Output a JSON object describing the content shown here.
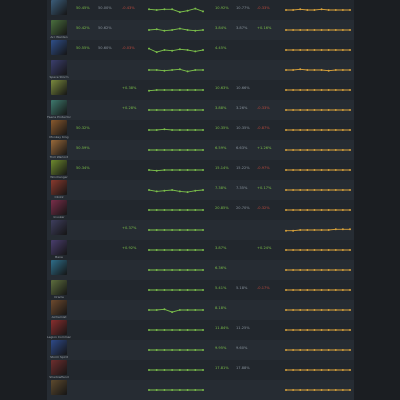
{
  "colors": {
    "win_line": "#7bbf4a",
    "pick_line": "#d9a23a",
    "positive": "#7bbf4a",
    "negative": "#b94a3e"
  },
  "heroes": [
    {
      "name": "",
      "icon": "hero-portrait-icon",
      "color": "#3b5d7a",
      "win_rate": "50.45%",
      "avg_win": "50.00%",
      "win_change": "-0.43%",
      "win_trend": [
        0.55,
        0.5,
        0.55,
        0.55,
        0.35,
        0.45,
        0.6,
        0.4
      ],
      "pick_rate": "10.92%",
      "avg_pick": "10.77%",
      "pick_change": "-0.33%",
      "pick_trend": [
        0.5,
        0.5,
        0.55,
        0.5,
        0.5,
        0.55,
        0.5,
        0.5,
        0.5,
        0.5
      ]
    },
    {
      "name": "Arc Warden",
      "icon": "hero-portrait-icon",
      "color": "#4a6f3e",
      "win_rate": "50.42%",
      "avg_win": "50.62%",
      "win_change": "",
      "win_trend": [
        0.5,
        0.55,
        0.45,
        0.5,
        0.6,
        0.5,
        0.45,
        0.5
      ],
      "pick_rate": "3.84%",
      "avg_pick": "3.87%",
      "pick_change": "+0.16%",
      "pick_trend": [
        0.5,
        0.5,
        0.5,
        0.5,
        0.5,
        0.5,
        0.5,
        0.5,
        0.5,
        0.5
      ]
    },
    {
      "name": "",
      "icon": "hero-portrait-icon",
      "color": "#2f4f8a",
      "win_rate": "50.55%",
      "avg_win": "50.60%",
      "win_change": "-0.03%",
      "win_trend": [
        0.6,
        0.35,
        0.5,
        0.45,
        0.55,
        0.5,
        0.4,
        0.5
      ],
      "pick_rate": "4.45%",
      "avg_pick": "",
      "pick_change": "",
      "pick_trend": [
        0.5,
        0.5,
        0.5,
        0.5,
        0.5,
        0.5,
        0.5,
        0.5,
        0.5,
        0.5
      ]
    },
    {
      "name": "Space Storm",
      "icon": "hero-portrait-icon",
      "color": "#3b3f6e",
      "win_rate": "",
      "avg_win": "",
      "win_change": "",
      "win_trend": [
        0.5,
        0.5,
        0.45,
        0.5,
        0.55,
        0.4,
        0.5,
        0.5
      ],
      "pick_rate": "",
      "avg_pick": "",
      "pick_change": "",
      "pick_trend": [
        0.5,
        0.5,
        0.55,
        0.5,
        0.5,
        0.5,
        0.45,
        0.5,
        0.5,
        0.5
      ]
    },
    {
      "name": "",
      "icon": "hero-portrait-icon",
      "color": "#7a8a3e",
      "win_rate": "",
      "avg_win": "",
      "win_change": "+0.38%",
      "win_trend": [
        0.45,
        0.5,
        0.5,
        0.5,
        0.5,
        0.5,
        0.5,
        0.5
      ],
      "pick_rate": "10.63%",
      "avg_pick": "10.66%",
      "pick_change": "",
      "pick_trend": [
        0.5,
        0.5,
        0.5,
        0.5,
        0.5,
        0.5,
        0.5,
        0.5,
        0.5,
        0.5
      ]
    },
    {
      "name": "Faerie Protector",
      "icon": "hero-portrait-icon",
      "color": "#3e7a6e",
      "win_rate": "",
      "avg_win": "",
      "win_change": "+0.28%",
      "win_trend": [
        0.5,
        0.5,
        0.5,
        0.5,
        0.5,
        0.5,
        0.5,
        0.5
      ],
      "pick_rate": "3.88%",
      "avg_pick": "3.26%",
      "pick_change": "-0.33%",
      "pick_trend": [
        0.5,
        0.5,
        0.5,
        0.5,
        0.5,
        0.5,
        0.5,
        0.5,
        0.5,
        0.5
      ]
    },
    {
      "name": "Monkey King",
      "icon": "hero-portrait-icon",
      "color": "#8a5a2e",
      "win_rate": "50.32%",
      "avg_win": "",
      "win_change": "",
      "win_trend": [
        0.5,
        0.5,
        0.55,
        0.5,
        0.5,
        0.5,
        0.5,
        0.5
      ],
      "pick_rate": "10.35%",
      "avg_pick": "10.35%",
      "pick_change": "-0.87%",
      "pick_trend": [
        0.5,
        0.5,
        0.5,
        0.5,
        0.5,
        0.5,
        0.5,
        0.5,
        0.5,
        0.5
      ]
    },
    {
      "name": "Troll Warlord",
      "icon": "hero-portrait-icon",
      "color": "#9a6a3a",
      "win_rate": "50.59%",
      "avg_win": "",
      "win_change": "",
      "win_trend": [
        0.5,
        0.5,
        0.5,
        0.5,
        0.5,
        0.5,
        0.5,
        0.5
      ],
      "pick_rate": "6.59%",
      "avg_pick": "6.63%",
      "pick_change": "+1.26%",
      "pick_trend": [
        0.5,
        0.5,
        0.5,
        0.5,
        0.5,
        0.5,
        0.5,
        0.5,
        0.5,
        0.5
      ]
    },
    {
      "name": "Windranger",
      "icon": "hero-portrait-icon",
      "color": "#6e8a2e",
      "win_rate": "50.34%",
      "avg_win": "",
      "win_change": "",
      "win_trend": [
        0.5,
        0.45,
        0.5,
        0.5,
        0.5,
        0.5,
        0.5,
        0.5
      ],
      "pick_rate": "15.14%",
      "avg_pick": "15.22%",
      "pick_change": "-0.97%",
      "pick_trend": [
        0.5,
        0.5,
        0.5,
        0.5,
        0.5,
        0.5,
        0.5,
        0.5,
        0.5,
        0.5
      ]
    },
    {
      "name": "Clinkz",
      "icon": "hero-portrait-icon",
      "color": "#8a3a2e",
      "win_rate": "",
      "avg_win": "",
      "win_change": "",
      "win_trend": [
        0.5,
        0.4,
        0.45,
        0.5,
        0.4,
        0.35,
        0.45,
        0.5
      ],
      "pick_rate": "7.38%",
      "avg_pick": "7.35%",
      "pick_change": "+0.17%",
      "pick_trend": [
        0.5,
        0.5,
        0.5,
        0.5,
        0.5,
        0.5,
        0.5,
        0.5,
        0.5,
        0.5
      ]
    },
    {
      "name": "Invoker",
      "icon": "hero-portrait-icon",
      "color": "#7a2e4a",
      "win_rate": "",
      "avg_win": "",
      "win_change": "",
      "win_trend": [
        0.5,
        0.5,
        0.5,
        0.5,
        0.5,
        0.5,
        0.5,
        0.5
      ],
      "pick_rate": "20.85%",
      "avg_pick": "20.70%",
      "pick_change": "-0.32%",
      "pick_trend": [
        0.5,
        0.5,
        0.5,
        0.5,
        0.5,
        0.5,
        0.5,
        0.5,
        0.5,
        0.5
      ]
    },
    {
      "name": "",
      "icon": "hero-portrait-icon",
      "color": "#3e3e5e",
      "win_rate": "",
      "avg_win": "",
      "win_change": "+0.37%",
      "win_trend": [
        0.5,
        0.5,
        0.5,
        0.5,
        0.5,
        0.5,
        0.5,
        0.5
      ],
      "pick_rate": "",
      "avg_pick": "",
      "pick_change": "",
      "pick_trend": [
        0.45,
        0.45,
        0.5,
        0.5,
        0.5,
        0.5,
        0.5,
        0.55,
        0.55,
        0.55
      ]
    },
    {
      "name": "Bane",
      "icon": "hero-portrait-icon",
      "color": "#4a3e6e",
      "win_rate": "",
      "avg_win": "",
      "win_change": "+0.92%",
      "win_trend": [
        0.5,
        0.5,
        0.5,
        0.5,
        0.5,
        0.5,
        0.5,
        0.5
      ],
      "pick_rate": "3.87%",
      "avg_pick": "",
      "pick_change": "+0.24%",
      "pick_trend": [
        0.5,
        0.5,
        0.5,
        0.5,
        0.5,
        0.5,
        0.5,
        0.5,
        0.5,
        0.5
      ]
    },
    {
      "name": "",
      "icon": "hero-portrait-icon",
      "color": "#2e6e8a",
      "win_rate": "",
      "avg_win": "",
      "win_change": "",
      "win_trend": [
        0.5,
        0.5,
        0.5,
        0.5,
        0.5,
        0.5,
        0.5,
        0.5
      ],
      "pick_rate": "6.36%",
      "avg_pick": "",
      "pick_change": "",
      "pick_trend": [
        0.5,
        0.5,
        0.5,
        0.5,
        0.5,
        0.5,
        0.5,
        0.5,
        0.5,
        0.5
      ]
    },
    {
      "name": "Oracle",
      "icon": "hero-portrait-icon",
      "color": "#5e6e3e",
      "win_rate": "",
      "avg_win": "",
      "win_change": "",
      "win_trend": [
        0.5,
        0.5,
        0.5,
        0.5,
        0.5,
        0.5,
        0.5,
        0.5
      ],
      "pick_rate": "5.41%",
      "avg_pick": "5.18%",
      "pick_change": "-0.17%",
      "pick_trend": [
        0.5,
        0.5,
        0.5,
        0.5,
        0.5,
        0.5,
        0.5,
        0.5,
        0.5,
        0.5
      ]
    },
    {
      "name": "Alchemist",
      "icon": "hero-portrait-icon",
      "color": "#6e4a2e",
      "win_rate": "",
      "avg_win": "",
      "win_change": "",
      "win_trend": [
        0.5,
        0.5,
        0.55,
        0.35,
        0.5,
        0.5,
        0.5,
        0.5
      ],
      "pick_rate": "8.18%",
      "avg_pick": "",
      "pick_change": "",
      "pick_trend": [
        0.5,
        0.5,
        0.5,
        0.5,
        0.5,
        0.5,
        0.5,
        0.5,
        0.5,
        0.5
      ]
    },
    {
      "name": "Legion Commander",
      "icon": "hero-portrait-icon",
      "color": "#8a2e2e",
      "win_rate": "",
      "avg_win": "",
      "win_change": "",
      "win_trend": [
        0.5,
        0.5,
        0.5,
        0.5,
        0.5,
        0.5,
        0.5,
        0.5
      ],
      "pick_rate": "11.84%",
      "avg_pick": "11.25%",
      "pick_change": "",
      "pick_trend": [
        0.5,
        0.5,
        0.5,
        0.5,
        0.5,
        0.5,
        0.5,
        0.5,
        0.5,
        0.5
      ]
    },
    {
      "name": "Storm Spirit",
      "icon": "hero-portrait-icon",
      "color": "#2e4a8a",
      "win_rate": "",
      "avg_win": "",
      "win_change": "",
      "win_trend": [
        0.5,
        0.5,
        0.5,
        0.5,
        0.5,
        0.5,
        0.5,
        0.5
      ],
      "pick_rate": "9.95%",
      "avg_pick": "9.60%",
      "pick_change": "",
      "pick_trend": [
        0.5,
        0.5,
        0.5,
        0.5,
        0.5,
        0.5,
        0.5,
        0.5,
        0.5,
        0.5
      ]
    },
    {
      "name": "Shadowfiend",
      "icon": "hero-portrait-icon",
      "color": "#6e2e2e",
      "win_rate": "",
      "avg_win": "",
      "win_change": "",
      "win_trend": [
        0.5,
        0.5,
        0.5,
        0.5,
        0.5,
        0.5,
        0.5,
        0.5
      ],
      "pick_rate": "17.81%",
      "avg_pick": "17.88%",
      "pick_change": "",
      "pick_trend": [
        0.5,
        0.5,
        0.5,
        0.5,
        0.5,
        0.5,
        0.5,
        0.5,
        0.5,
        0.5
      ]
    },
    {
      "name": "",
      "icon": "hero-portrait-icon",
      "color": "#5e4a2e",
      "win_rate": "",
      "avg_win": "",
      "win_change": "",
      "win_trend": [
        0.5,
        0.5,
        0.5,
        0.5,
        0.5,
        0.5,
        0.5,
        0.5
      ],
      "pick_rate": "",
      "avg_pick": "",
      "pick_change": "",
      "pick_trend": [
        0.5,
        0.5,
        0.5,
        0.5,
        0.5,
        0.5,
        0.5,
        0.5,
        0.5,
        0.5
      ]
    }
  ]
}
